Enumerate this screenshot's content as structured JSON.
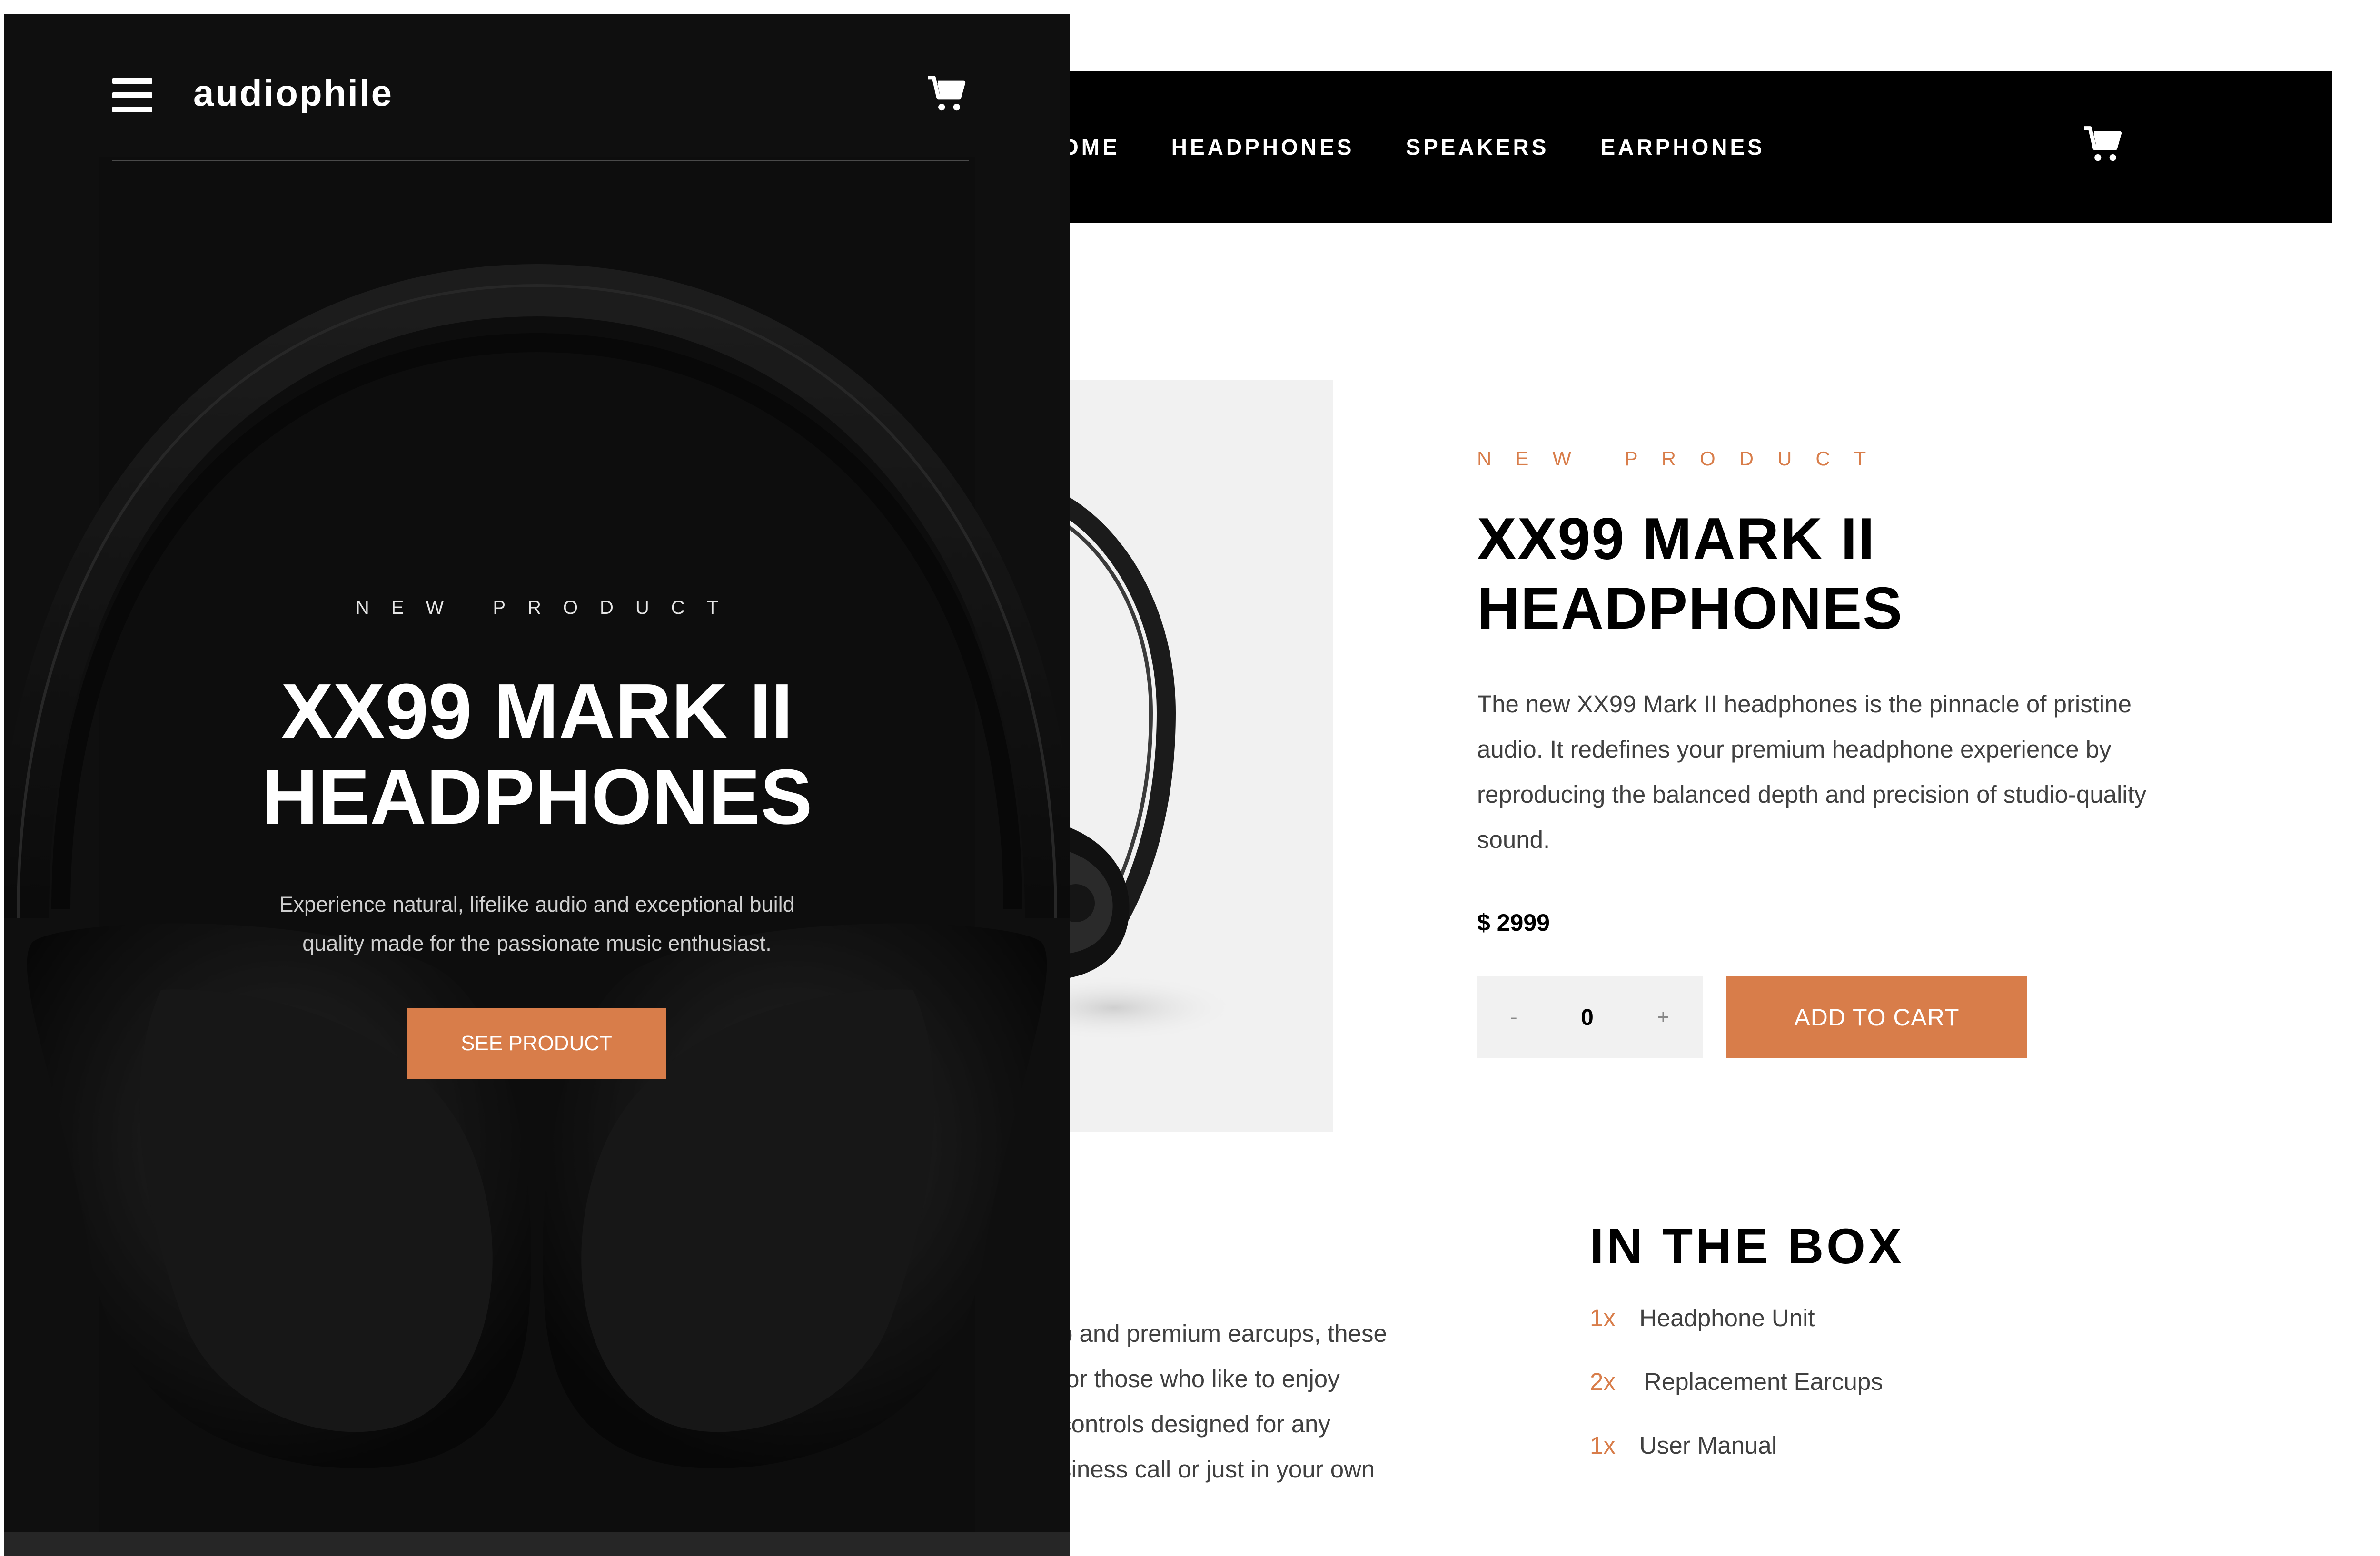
{
  "desktop": {
    "nav": {
      "links": [
        "OME",
        "HEADPHONES",
        "SPEAKERS",
        "EARPHONES"
      ]
    },
    "cart_icon": "cart-icon",
    "product": {
      "eyebrow": "NEW PRODUCT",
      "title": "XX99 MARK II HEADPHONES",
      "description": "The new XX99 Mark II headphones is the pinnacle of pristine audio. It redefines your premium headphone experience by reproducing the balanced depth and precision of studio-quality sound.",
      "price": "$ 2999",
      "quantity": {
        "decrement": "-",
        "value": "0",
        "increment": "+"
      },
      "add_to_cart": "ADD TO CART"
    },
    "features_fragment": [
      "p and premium earcups, these",
      " for those who like to enjoy",
      " controls designed for any",
      "siness call or just in your own"
    ],
    "in_the_box": {
      "title": "IN THE BOX",
      "items": [
        {
          "qty": "1x",
          "name": "Headphone Unit"
        },
        {
          "qty": "2x",
          "name": "Replacement Earcups"
        },
        {
          "qty": "1x",
          "name": "User Manual"
        }
      ]
    }
  },
  "mobile": {
    "logo": "audiophile",
    "menu_icon": "hamburger-menu-icon",
    "cart_icon": "cart-icon",
    "hero": {
      "eyebrow": "NEW PRODUCT",
      "title_line1": "XX99 MARK II",
      "title_line2": "HEADPHONES",
      "description_line1": "Experience natural, lifelike audio and exceptional build",
      "description_line2": "quality made for the passionate music enthusiast.",
      "cta": "SEE PRODUCT"
    }
  },
  "colors": {
    "accent": "#d87d4a",
    "nav_background": "#000000",
    "mobile_background": "#181818",
    "panel_gray": "#f1f1f1",
    "body_text": "#404040"
  }
}
